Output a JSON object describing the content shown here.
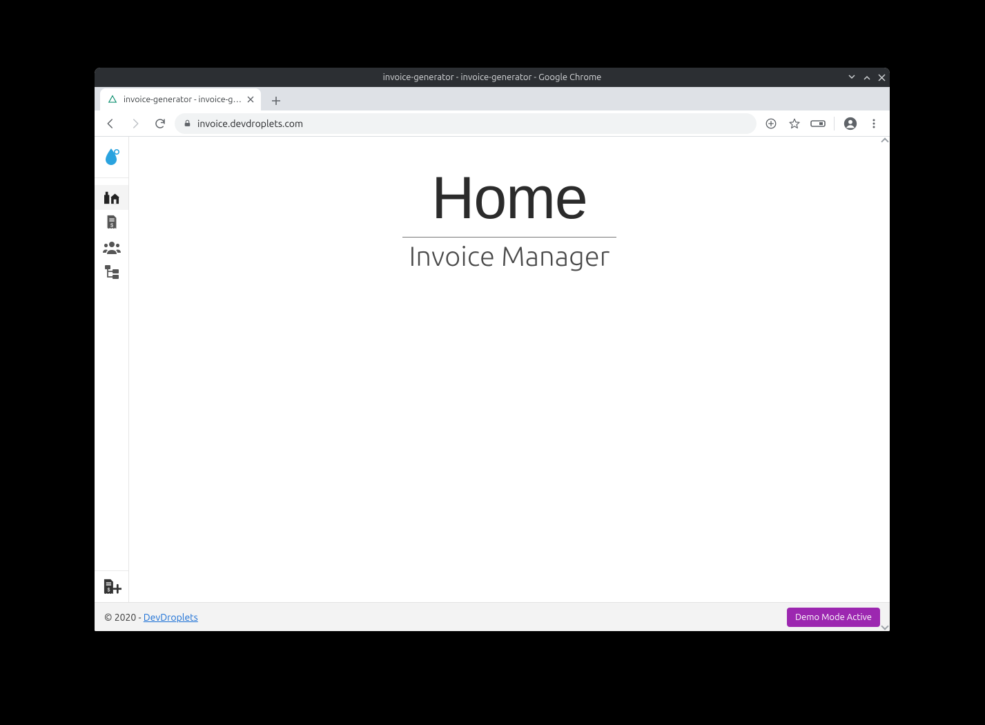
{
  "window": {
    "title": "invoice-generator - invoice-generator - Google Chrome"
  },
  "tab": {
    "title": "invoice-generator - invoice-g…"
  },
  "address_bar": {
    "url": "invoice.devdroplets.com"
  },
  "sidebar": {
    "items": [
      {
        "name": "home",
        "icon": "home-icon"
      },
      {
        "name": "invoices",
        "icon": "invoice-icon"
      },
      {
        "name": "clients",
        "icon": "people-icon"
      },
      {
        "name": "categories",
        "icon": "tree-icon"
      }
    ],
    "bottom_action_icon": "new-invoice-icon"
  },
  "main": {
    "title": "Home",
    "subtitle": "Invoice Manager"
  },
  "footer": {
    "copyright": "© 2020 - ",
    "link_text": "DevDroplets",
    "demo_badge": "Demo Mode Active"
  }
}
